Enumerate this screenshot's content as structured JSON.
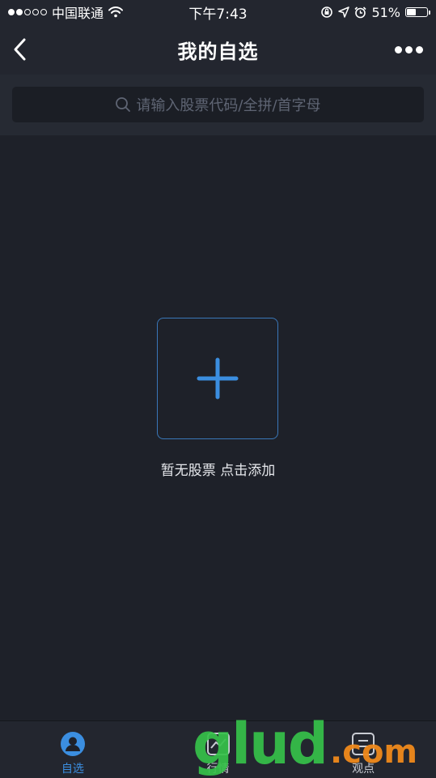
{
  "status_bar": {
    "carrier": "中国联通",
    "time": "下午7:43",
    "battery": "51%",
    "battery_level": 0.51
  },
  "header": {
    "title": "我的自选"
  },
  "search": {
    "placeholder": "请输入股票代码/全拼/首字母"
  },
  "empty_state": {
    "text": "暂无股票 点击添加"
  },
  "tabs": [
    {
      "label": "自选",
      "icon": "user-circle-icon",
      "active": true
    },
    {
      "label": "行情",
      "icon": "chart-icon",
      "active": false
    },
    {
      "label": "观点",
      "icon": "list-icon",
      "active": false
    }
  ],
  "watermark": {
    "brand": "glud",
    "suffix": ".com"
  },
  "colors": {
    "accent": "#3b8ee0",
    "background": "#1e2129",
    "bar": "#23262f"
  }
}
